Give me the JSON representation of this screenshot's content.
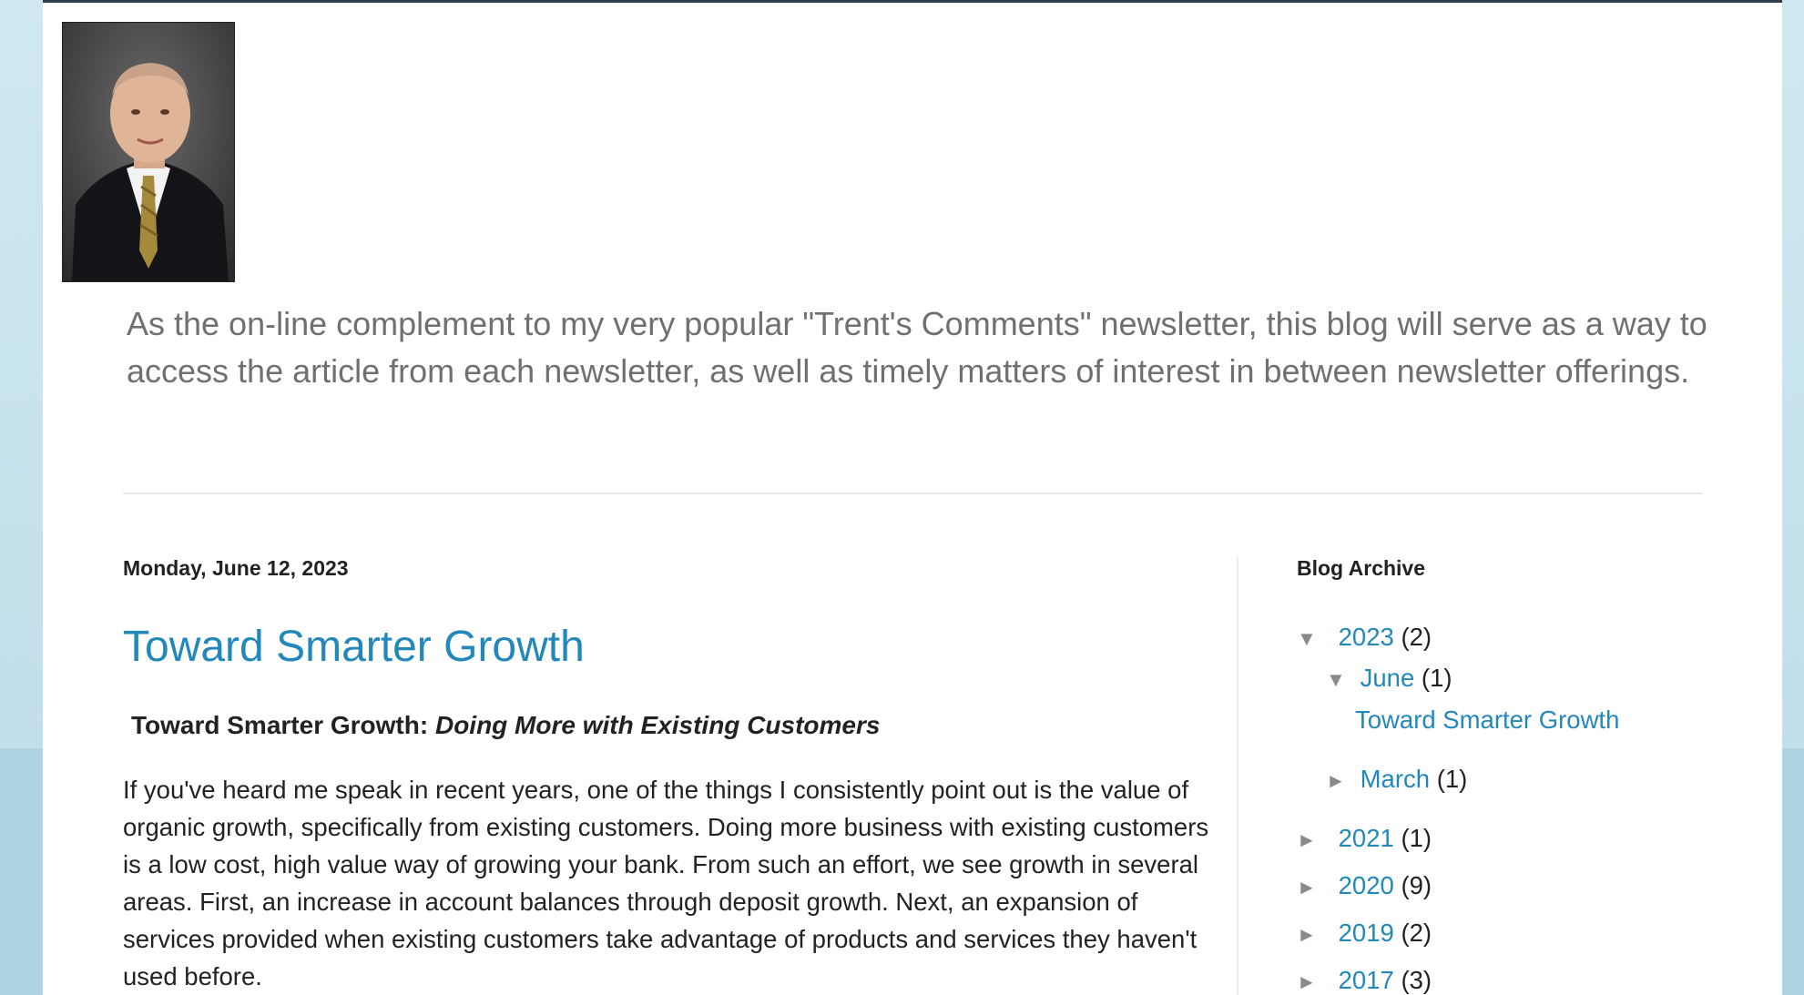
{
  "header": {
    "description": "As the on-line complement to my very popular \"Trent's Comments\" newsletter, this blog will serve as a way to access the article from each newsletter, as well as timely matters of interest in between newsletter offerings."
  },
  "post": {
    "date": "Monday, June 12, 2023",
    "title": "Toward Smarter Growth",
    "subtitle_plain": "Toward Smarter Growth: ",
    "subtitle_italic": "Doing More with Existing Customers",
    "body": "If you've heard me speak in recent years, one of the things I consistently point out is the value of organic growth, specifically from existing customers.  Doing more business with existing customers is a low cost, high value way of growing your bank.  From such an effort, we see growth in several areas.  First, an increase in account balances through deposit growth.  Next, an expansion of services provided when existing customers take advantage of products and services they haven't used before."
  },
  "sidebar": {
    "archive_title": "Blog Archive",
    "items": [
      {
        "toggle": "▼",
        "label": "2023",
        "count": "(2)"
      },
      {
        "toggle": "▼",
        "label": "June",
        "count": "(1)"
      },
      {
        "label": "Toward Smarter Growth"
      },
      {
        "toggle": "►",
        "label": "March",
        "count": "(1)"
      },
      {
        "toggle": "►",
        "label": "2021",
        "count": "(1)"
      },
      {
        "toggle": "►",
        "label": "2020",
        "count": "(9)"
      },
      {
        "toggle": "►",
        "label": "2019",
        "count": "(2)"
      },
      {
        "toggle": "►",
        "label": "2017",
        "count": "(3)"
      }
    ]
  },
  "colors": {
    "link": "#2288bb",
    "description_text": "#707070",
    "body_text": "#222222",
    "background": "#c4e1ec"
  }
}
